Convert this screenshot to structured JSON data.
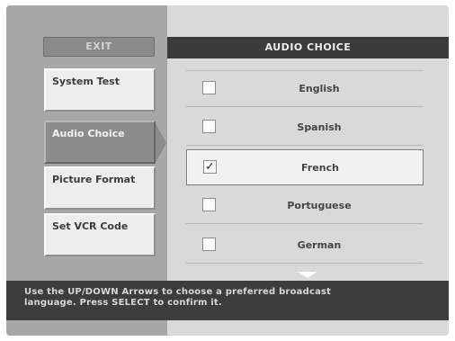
{
  "menu": {
    "exit_label": "EXIT",
    "items": [
      {
        "label": "System Test"
      },
      {
        "label": "Audio Choice"
      },
      {
        "label": "Picture Format"
      },
      {
        "label": "Set VCR Code"
      }
    ],
    "selected_item": "Audio Choice"
  },
  "panel": {
    "title": "AUDIO CHOICE",
    "options": [
      {
        "label": "English",
        "checked": false,
        "check_mark": ""
      },
      {
        "label": "Spanish",
        "checked": false,
        "check_mark": ""
      },
      {
        "label": "French",
        "checked": true,
        "check_mark": "✓"
      },
      {
        "label": "Portuguese",
        "checked": false,
        "check_mark": ""
      },
      {
        "label": "German",
        "checked": false,
        "check_mark": ""
      }
    ]
  },
  "help": {
    "line1": "Use the UP/DOWN Arrows to choose a preferred broadcast",
    "line2": "language.  Press SELECT to confirm it."
  },
  "icons": {
    "selection_pointer": "triangle-right-icon",
    "scroll_down": "triangle-down-icon"
  },
  "colors": {
    "left_panel": "#a7a7a7",
    "right_panel": "#d9d9d9",
    "title_bar": "#3b3b3b",
    "help_bar": "#3d3d3d",
    "selected_menu": "#8c8c8c"
  }
}
